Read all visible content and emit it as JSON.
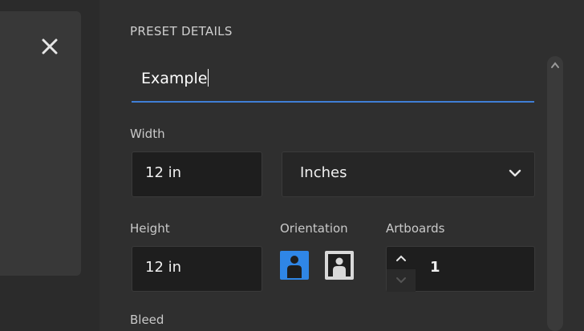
{
  "icons": {
    "close": "close-icon",
    "chevron": "chevron-down-icon",
    "portrait": "portrait-orientation-icon",
    "landscape": "landscape-orientation-icon",
    "step_up": "chevron-up-icon",
    "step_down": "chevron-down-icon",
    "scroll_up": "scroll-up-icon"
  },
  "colors": {
    "accent": "#2f86e6",
    "underline": "#3f7fd6",
    "panel": "#2f2f2f",
    "field": "#1e1e1e"
  },
  "preset": {
    "section_title": "PRESET DETAILS",
    "name_value": "Example"
  },
  "width": {
    "label": "Width",
    "value": "12 in",
    "units_selected": "Inches"
  },
  "height": {
    "label": "Height",
    "value": "12 in"
  },
  "orientation": {
    "label": "Orientation",
    "selected": "portrait"
  },
  "artboards": {
    "label": "Artboards",
    "value": "1"
  },
  "bleed": {
    "label": "Bleed"
  }
}
